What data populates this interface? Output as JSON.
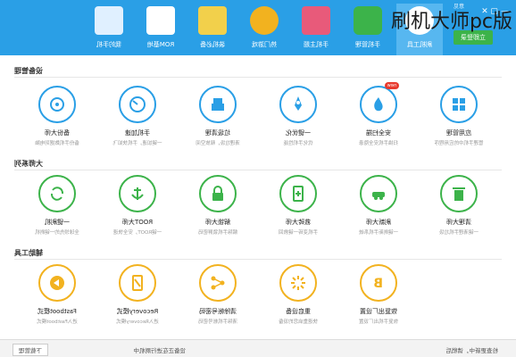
{
  "brand": {
    "title": "刷机大师pc版"
  },
  "window": {
    "small_tag": "意见",
    "login_button": "立即登录"
  },
  "topbar": {
    "items": [
      {
        "label": "刷机工具",
        "icon": "refresh-icon",
        "color": "#ffffff",
        "active": true
      },
      {
        "label": "手机管理",
        "icon": "shield-icon",
        "color": "#3cb34a"
      },
      {
        "label": "手机主题",
        "icon": "shirt-icon",
        "color": "#e85a7a"
      },
      {
        "label": "热门游戏",
        "icon": "gamepad-icon",
        "color": "#f2b21f"
      },
      {
        "label": "装机必备",
        "icon": "apps-icon",
        "color": "#f2d04b"
      },
      {
        "label": "ROM基地",
        "icon": "rom-icon",
        "color": "#2a9fe6"
      },
      {
        "label": "我的手机",
        "icon": "phone-icon",
        "color": "#ffffff"
      }
    ]
  },
  "sections": [
    {
      "title": "设备管理"
    },
    {
      "title": "大师系列"
    },
    {
      "title": "辅助工具"
    }
  ],
  "tools_row1": [
    {
      "name": "备份大师",
      "desc": "备份手机数据到电脑",
      "icon": "backup-icon"
    },
    {
      "name": "手机加速",
      "desc": "一键加速，手机快如飞",
      "icon": "speed-icon"
    },
    {
      "name": "垃圾清理",
      "desc": "清理垃圾，释放空间",
      "icon": "clean-icon"
    },
    {
      "name": "一键优化",
      "desc": "优化手机性能",
      "icon": "rocket-icon"
    },
    {
      "name": "安全扫描",
      "desc": "扫描手机安全隐患",
      "icon": "fire-icon",
      "badge": "new"
    },
    {
      "name": "应用管理",
      "desc": "管理手机中的应用程序",
      "icon": "grid-icon"
    }
  ],
  "tools_row2": [
    {
      "name": "一键刷机",
      "desc": "全球领先的一键刷机",
      "icon": "refresh-icon"
    },
    {
      "name": "ROOT大师",
      "desc": "一键ROOT，安全快速",
      "icon": "anchor-icon"
    },
    {
      "name": "解锁大师",
      "desc": "解除手机锁屏密码",
      "icon": "lock-icon"
    },
    {
      "name": "救砖大师",
      "desc": "手机变砖一键救回",
      "icon": "phone-plus-icon"
    },
    {
      "name": "刷新大师",
      "desc": "一键刷新手机系统",
      "icon": "car-icon"
    },
    {
      "name": "清理大师",
      "desc": "一键清理手机垃圾",
      "icon": "trash-icon"
    }
  ],
  "tools_row3": [
    {
      "name": "Fastboot模式",
      "desc": "进入Fastboot模式",
      "icon": "fastboot-icon"
    },
    {
      "name": "Recovery模式",
      "desc": "进入Recovery模式",
      "icon": "recovery-icon"
    },
    {
      "name": "清除帐号密码",
      "desc": "清除手机帐号密码",
      "icon": "share-icon"
    },
    {
      "name": "重启设备",
      "desc": "快速重启您的设备",
      "icon": "loading-icon"
    },
    {
      "name": "恢复出厂设置",
      "desc": "恢复手机出厂设置",
      "icon": "b-icon"
    }
  ],
  "statusbar": {
    "left": "检查更新中，请稍后",
    "mid": "设备正在进行刷机中",
    "right": "下载管理"
  }
}
